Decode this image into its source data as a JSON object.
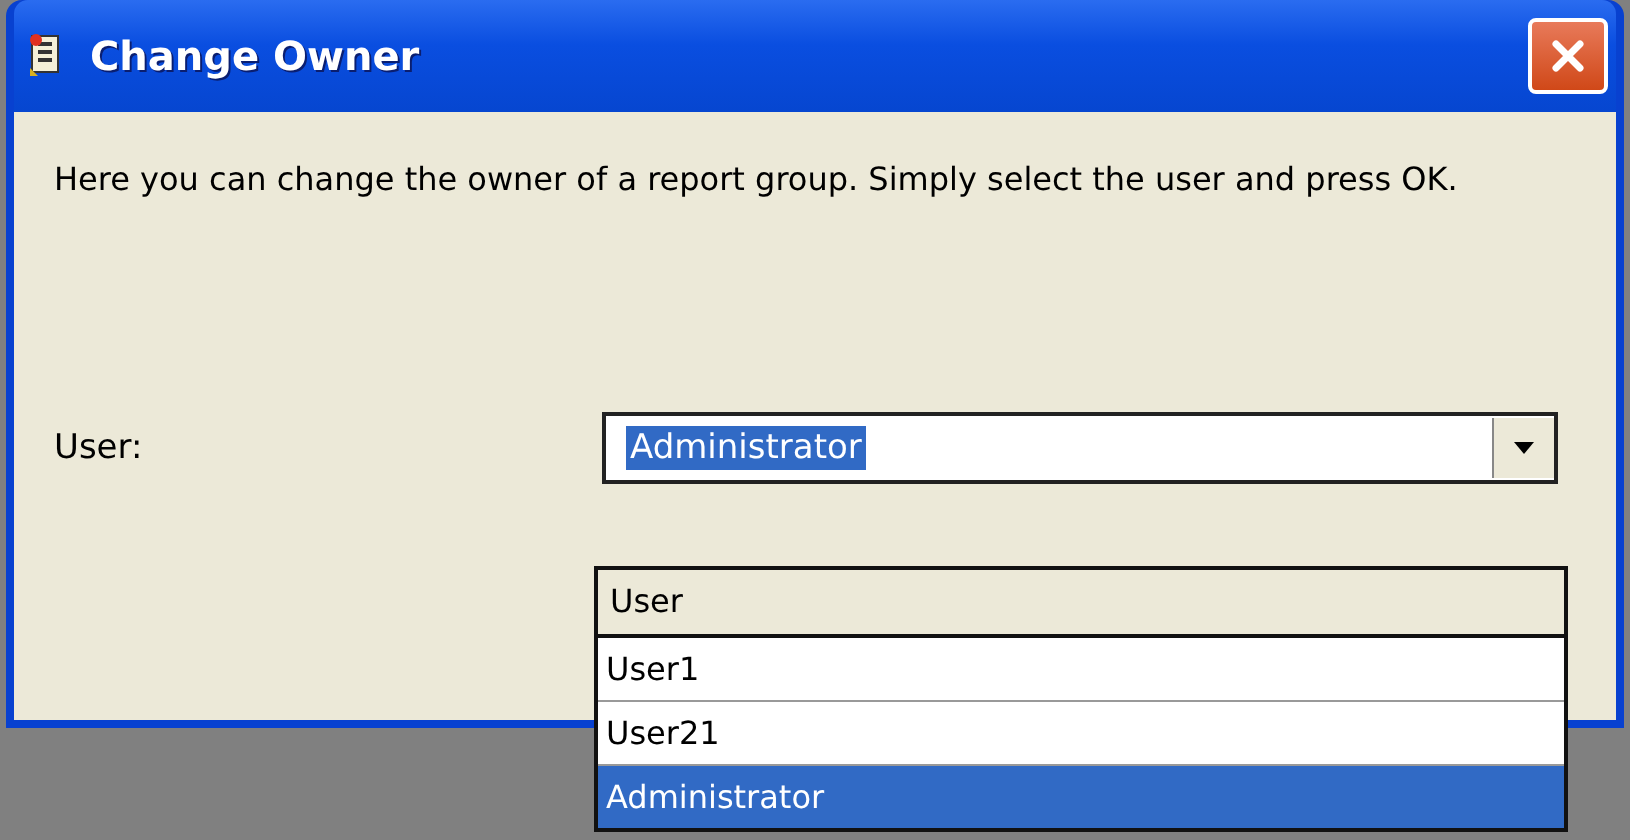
{
  "window": {
    "title": "Change Owner"
  },
  "message": "Here you can change the owner of a report group. Simply select the user and press OK.",
  "user_field": {
    "label": "User:",
    "value": "Administrator"
  },
  "dropdown": {
    "column": "User",
    "options": [
      {
        "label": "User1",
        "selected": false
      },
      {
        "label": "User21",
        "selected": false
      },
      {
        "label": "Administrator",
        "selected": true
      }
    ]
  }
}
